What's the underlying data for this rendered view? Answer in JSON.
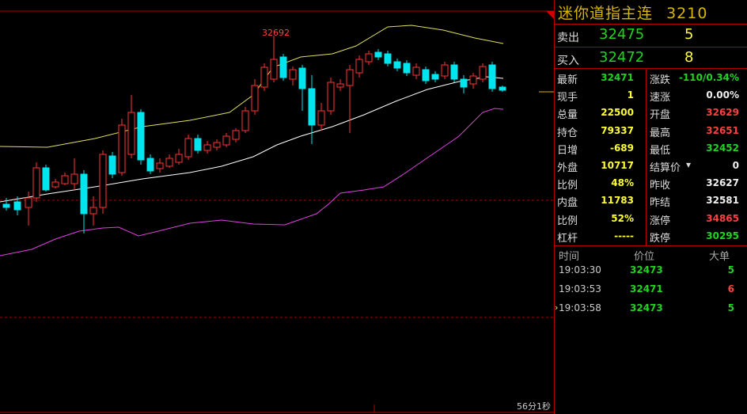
{
  "chart": {
    "peak_label": "32692",
    "elapsed_label": "56分1秒",
    "colors": {
      "up": "#ff3333",
      "down": "#00e5ee",
      "ma_mid": "#ffffff",
      "upper_band": "#e0e060",
      "lower_band": "#e040e0",
      "dash": "#b00000"
    }
  },
  "header": {
    "title": "迷你道指主连",
    "code": "3210"
  },
  "orderbook": {
    "sell": {
      "label": "卖出",
      "price": "32475",
      "volume": "5"
    },
    "buy": {
      "label": "买入",
      "price": "32472",
      "volume": "8"
    }
  },
  "quotes": [
    {
      "l1": "最新",
      "v1": "32471",
      "c1": "g",
      "l2": "涨跌",
      "v2": "-110/0.34%",
      "c2": "g"
    },
    {
      "l1": "现手",
      "v1": "1",
      "c1": "y",
      "l2": "速涨",
      "v2": "0.00%",
      "c2": "w"
    },
    {
      "l1": "总量",
      "v1": "22500",
      "c1": "y",
      "l2": "开盘",
      "v2": "32629",
      "c2": "r"
    },
    {
      "l1": "持仓",
      "v1": "79337",
      "c1": "y",
      "l2": "最高",
      "v2": "32651",
      "c2": "r"
    },
    {
      "l1": "日增",
      "v1": "-689",
      "c1": "y",
      "l2": "最低",
      "v2": "32452",
      "c2": "g"
    },
    {
      "l1": "外盘",
      "v1": "10717",
      "c1": "y",
      "l2": "结算价",
      "v2": "0",
      "c2": "w"
    },
    {
      "l1": "比例",
      "v1": "48%",
      "c1": "y",
      "l2": "昨收",
      "v2": "32627",
      "c2": "w"
    },
    {
      "l1": "内盘",
      "v1": "11783",
      "c1": "y",
      "l2": "昨结",
      "v2": "32581",
      "c2": "w"
    },
    {
      "l1": "比例",
      "v1": "52%",
      "c1": "y",
      "l2": "涨停",
      "v2": "34865",
      "c2": "r"
    },
    {
      "l1": "杠杆",
      "v1": "-----",
      "c1": "y",
      "l2": "跌停",
      "v2": "30295",
      "c2": "g"
    }
  ],
  "ticks_header": {
    "time": "时间",
    "price": "价位",
    "size": "大单"
  },
  "ticks": [
    {
      "time": "19:03:30",
      "price": "32473",
      "size": "5",
      "c": "g"
    },
    {
      "time": "19:03:53",
      "price": "32471",
      "size": "6",
      "c": "r"
    },
    {
      "time": "19:03:58",
      "price": "32473",
      "size": "5",
      "c": "g",
      "marker": "›"
    }
  ]
}
